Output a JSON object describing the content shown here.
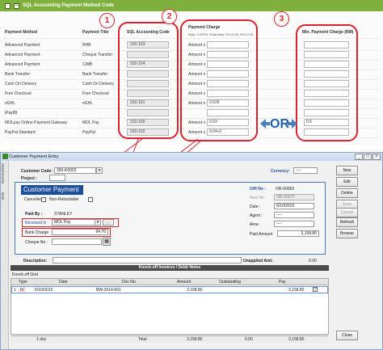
{
  "top": {
    "title": "SQL Accounting Payment Method Code",
    "headers": {
      "payment_method": "Payment Method",
      "payment_title": "Payment Title",
      "sql_code": "SQL Accounting Code",
      "payment_charge": "Payment Charge",
      "charge_note": "Note: i=100%. Examples: 3%=0.03, 5%=0.05",
      "min_charge": "Min. Payment Charge (RM)"
    },
    "rows": [
      {
        "method": "Advanced Payment",
        "title": "RHB",
        "code": "310-103",
        "amount_lbl": "Amount x",
        "amount": "",
        "min": ""
      },
      {
        "method": "Advanced Payment",
        "title": "Cheque Transfer",
        "code": "",
        "amount_lbl": "Amount x",
        "amount": "",
        "min": ""
      },
      {
        "method": "Advanced Payment",
        "title": "CIMB",
        "code": "310-104",
        "amount_lbl": "Amount x",
        "amount": "",
        "min": ""
      },
      {
        "method": "Bank Transfer",
        "title": "Bank Transfer",
        "code": "",
        "amount_lbl": "Amount x",
        "amount": "",
        "min": ""
      },
      {
        "method": "Cash On Delivery",
        "title": "Cash On Delivery",
        "code": "",
        "amount_lbl": "Amount x",
        "amount": "",
        "min": ""
      },
      {
        "method": "Free Checkout",
        "title": "Free Checkout",
        "code": "",
        "amount_lbl": "Amount x",
        "amount": "",
        "min": ""
      },
      {
        "method": "eGHL",
        "title": "eGHL",
        "code": "310-101",
        "amount_lbl": "Amount x",
        "amount": "0.028",
        "min": ""
      },
      {
        "method": "iPay88",
        "title": "",
        "code": "",
        "amount_lbl": "",
        "amount": "",
        "min": ""
      },
      {
        "method": "MOLpay Online Payment Gateway",
        "title": "MOL Pay",
        "code": "310-100",
        "amount_lbl": "Amount x",
        "amount": "0.03",
        "min": "0.6"
      },
      {
        "method": "PayPal Standard",
        "title": "PayPal",
        "code": "310-102",
        "amount_lbl": "Amount x",
        "amount": "0.04+2",
        "min": ""
      }
    ],
    "callouts": [
      "1",
      "2",
      "3"
    ],
    "or_label": "OR"
  },
  "window": {
    "title": "Customer Payment Entry",
    "side_tabs": [
      "Attachments",
      "Note"
    ],
    "customer_code_lbl": "Customer Code:",
    "customer_code": "300-K0002",
    "project_lbl": "Project :",
    "currency_lbl": "Currency:",
    "currency": "----",
    "section_title": "Customer Payment",
    "cancelled_lbl": "Cancelled",
    "non_refundable_lbl": "Non-Refundable",
    "paid_by_lbl": "Paid By :",
    "paid_by": "STANLEY",
    "received_in_lbl": "Received In",
    "received_in": "MOL Pay",
    "received_dots": "...",
    "bank_charge_lbl": "Bank Charge",
    "bank_charge": "94.76",
    "cheque_no_lbl": "Cheque No :",
    "or_no_lbl": "O/R No :",
    "or_no": "OR-00069",
    "next_no_lbl": "Next No :",
    "next_no": "OR-00070",
    "date_lbl": "Date :",
    "date": "6/10/2015",
    "agent_lbl": "Agent :",
    "agent": "----",
    "area_lbl": "Area :",
    "area": "----",
    "paid_amount_lbl": "Paid Amount",
    "paid_amount": "3,158.80",
    "description_lbl": "Description:",
    "unapplied_lbl": "Unapplied Amt:",
    "unapplied": "0.00",
    "knockoff_title": "Knock-off Invoices / Debit Notes",
    "knockoff_grid_lbl": "Knock-off Grid",
    "grid_headers": [
      "Type",
      "Date",
      "Doc No.",
      "Amount",
      "Outstanding",
      "Pay"
    ],
    "grid_row": {
      "num": "1",
      "type": "IV",
      "date": "6/10/2015",
      "doc": "BW-2014-001",
      "amount": "3,158.80",
      "outstanding": "",
      "pay": "3,158.80"
    },
    "footer": {
      "count": "1 doc",
      "total_lbl": "Total",
      "amount": "3,158.80",
      "outstanding": "0.00",
      "pay": "3,158.80"
    },
    "buttons": {
      "new": "New",
      "edit": "Edit",
      "delete": "Delete",
      "save": "Save",
      "cancel": "Cancel",
      "refresh": "Refresh",
      "browse": "Browse",
      "close": "Close"
    }
  }
}
